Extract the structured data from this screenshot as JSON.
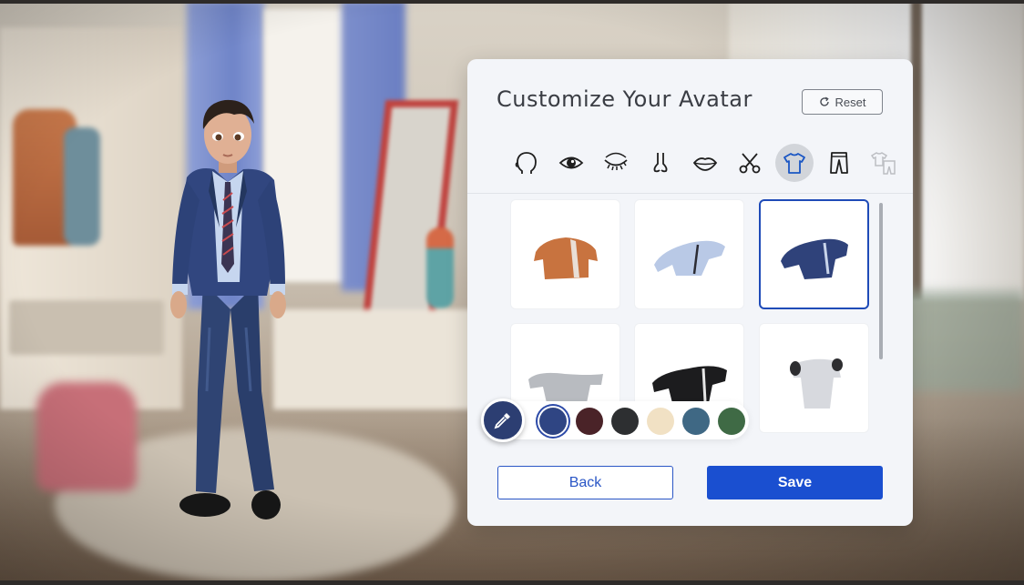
{
  "panel": {
    "title": "Customize Your Avatar",
    "reset_label": "Reset",
    "back_label": "Back",
    "save_label": "Save"
  },
  "tabs": [
    {
      "icon": "head-shape-icon",
      "active": false,
      "enabled": true
    },
    {
      "icon": "eye-icon",
      "active": false,
      "enabled": true
    },
    {
      "icon": "eyelash-icon",
      "active": false,
      "enabled": true
    },
    {
      "icon": "nose-icon",
      "active": false,
      "enabled": true
    },
    {
      "icon": "lips-icon",
      "active": false,
      "enabled": true
    },
    {
      "icon": "scissors-icon",
      "active": false,
      "enabled": true
    },
    {
      "icon": "shirt-icon",
      "active": true,
      "enabled": true
    },
    {
      "icon": "pants-icon",
      "active": false,
      "enabled": true
    },
    {
      "icon": "outfit-icon",
      "active": false,
      "enabled": false
    }
  ],
  "items": [
    {
      "name": "orange-jacket",
      "color": "#c8733f",
      "selected": false
    },
    {
      "name": "light-blue-jacket",
      "color": "#b9c9e6",
      "selected": false
    },
    {
      "name": "navy-blazer",
      "color": "#2f427a",
      "selected": true
    },
    {
      "name": "gray-jacket",
      "color": "#b8bbc0",
      "selected": false
    },
    {
      "name": "black-jacket",
      "color": "#1c1c1e",
      "selected": false
    },
    {
      "name": "white-shirt",
      "color": "#d7d9de",
      "selected": false
    }
  ],
  "palette": {
    "picker_icon": "eyedropper-icon",
    "swatches": [
      {
        "color": "#2f4583",
        "selected": true
      },
      {
        "color": "#4a2328",
        "selected": false
      },
      {
        "color": "#2d2f31",
        "selected": false
      },
      {
        "color": "#f1e1c4",
        "selected": false
      },
      {
        "color": "#3f6884",
        "selected": false
      },
      {
        "color": "#3f6a45",
        "selected": false
      }
    ]
  }
}
